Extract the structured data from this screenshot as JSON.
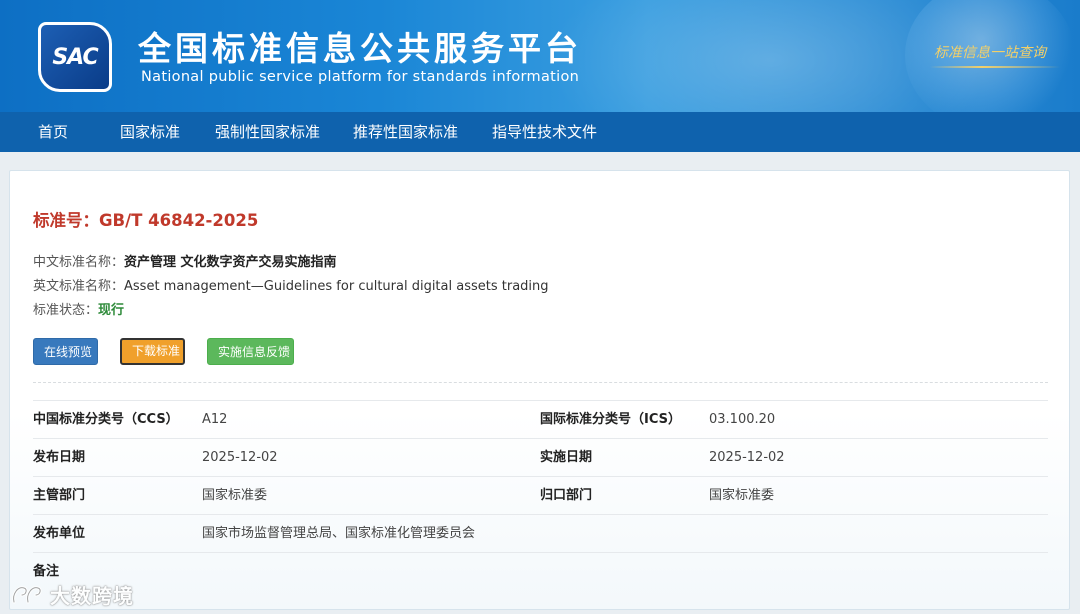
{
  "header": {
    "logo_text": "SAC",
    "title_cn": "全国标准信息公共服务平台",
    "title_en": "National public service platform  for standards information",
    "slogan": "标准信息一站查询"
  },
  "nav": {
    "items": [
      {
        "label": "首页"
      },
      {
        "label": "国家标准"
      },
      {
        "label": "强制性国家标准"
      },
      {
        "label": "推荐性国家标准"
      },
      {
        "label": "指导性技术文件"
      }
    ]
  },
  "standard": {
    "number_label": "标准号：",
    "number": "GB/T 46842-2025",
    "cn_name_label": "中文标准名称：",
    "cn_name": "资产管理 文化数字资产交易实施指南",
    "en_name_label": "英文标准名称：",
    "en_name": "Asset management—Guidelines for cultural digital assets trading",
    "status_label": "标准状态：",
    "status": "现行"
  },
  "buttons": {
    "preview": "在线预览",
    "download": "下载标准",
    "feedback": "实施信息反馈"
  },
  "details": {
    "rows": [
      {
        "k1": "中国标准分类号（CCS）",
        "v1": "A12",
        "k2": "国际标准分类号（ICS）",
        "v2": "03.100.20"
      },
      {
        "k1": "发布日期",
        "v1": "2025-12-02",
        "k2": "实施日期",
        "v2": "2025-12-02"
      },
      {
        "k1": "主管部门",
        "v1": "国家标准委",
        "k2": "归口部门",
        "v2": "国家标准委"
      },
      {
        "k1": "发布单位",
        "v1": "国家市场监督管理总局、国家标准化管理委员会",
        "k2": "",
        "v2": ""
      },
      {
        "k1": "备注",
        "v1": "",
        "k2": "",
        "v2": ""
      }
    ]
  },
  "watermark": {
    "text": "大数跨境"
  },
  "colors": {
    "header_blue": "#1a86d6",
    "nav_blue": "#0f62ad",
    "title_red": "#c0392b",
    "status_green": "#2e8b3a",
    "btn_blue": "#3879bd",
    "btn_orange": "#f0a02b",
    "btn_green": "#5cb85c"
  }
}
